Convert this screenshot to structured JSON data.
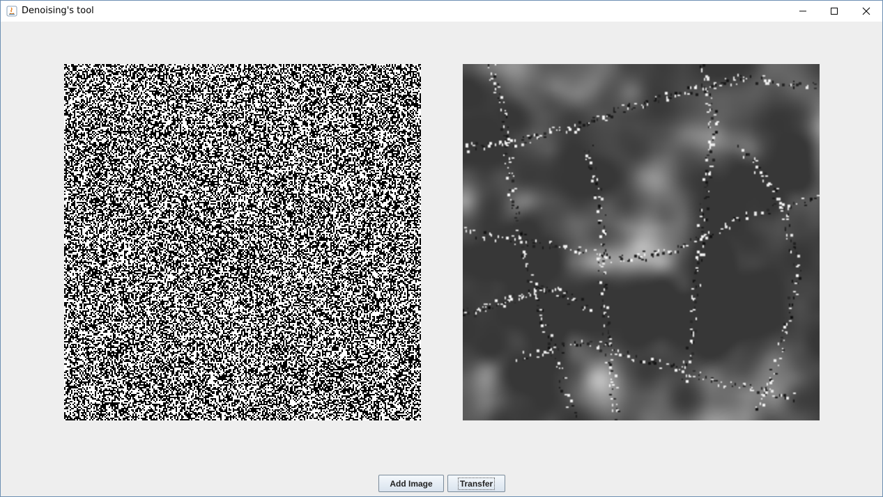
{
  "window": {
    "title": "Denoising's tool",
    "controls": {
      "minimize_icon": "minimize-icon",
      "maximize_icon": "maximize-icon",
      "close_icon": "close-icon"
    }
  },
  "images": {
    "input": {
      "description_icon": "noisy-image",
      "style": "binary-noise"
    },
    "output": {
      "description_icon": "denoised-cloud-image",
      "style": "grayscale-clouds"
    }
  },
  "buttons": {
    "add_image": "Add Image",
    "transfer": "Transfer"
  },
  "colors": {
    "window_bg": "#eeeeee",
    "titlebar_bg": "#ffffff",
    "border": "#6d8fb3"
  }
}
